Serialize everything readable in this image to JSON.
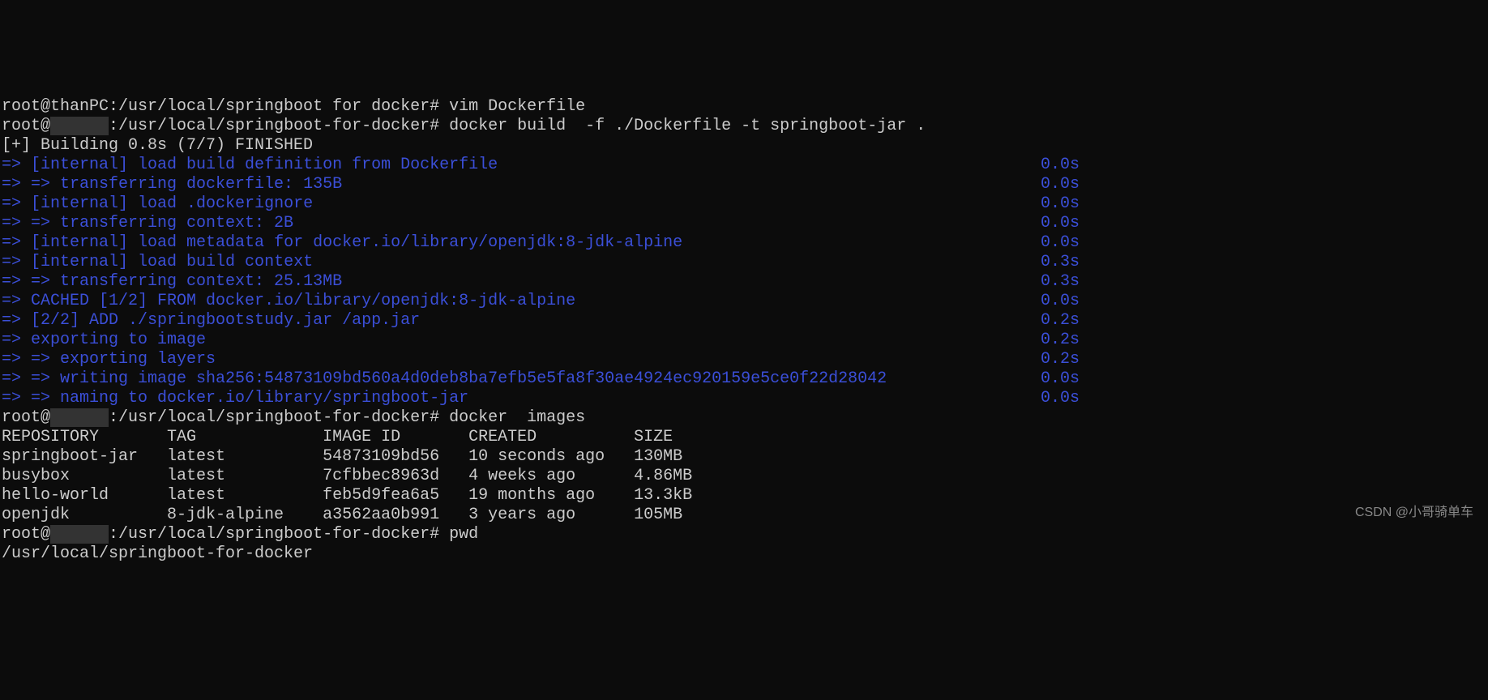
{
  "line0": "root@thanPC:/usr/local/springboot for docker# vim Dockerfile",
  "prompt1_a": "root@",
  "prompt1_blur": "      ",
  "prompt1_b": ":/usr/local/springboot-for-docker# ",
  "cmd1": "docker build  -f ./Dockerfile -t springboot-jar .",
  "building": "[+] Building 0.8s (7/7) FINISHED",
  "arrow1": "=> ",
  "arrow2": "=> => ",
  "steps": [
    {
      "pre": "=> ",
      "text": "[internal] load build definition from Dockerfile",
      "time": "0.0s"
    },
    {
      "pre": "=> => ",
      "text": "transferring dockerfile: 135B",
      "time": "0.0s"
    },
    {
      "pre": "=> ",
      "text": "[internal] load .dockerignore",
      "time": "0.0s"
    },
    {
      "pre": "=> => ",
      "text": "transferring context: 2B",
      "time": "0.0s"
    },
    {
      "pre": "=> ",
      "text": "[internal] load metadata for docker.io/library/openjdk:8-jdk-alpine",
      "time": "0.0s"
    },
    {
      "pre": "=> ",
      "text": "[internal] load build context",
      "time": "0.3s"
    },
    {
      "pre": "=> => ",
      "text": "transferring context: 25.13MB",
      "time": "0.3s"
    },
    {
      "pre": "=> ",
      "text": "CACHED [1/2] FROM docker.io/library/openjdk:8-jdk-alpine",
      "time": "0.0s"
    },
    {
      "pre": "=> ",
      "text": "[2/2] ADD ./springbootstudy.jar /app.jar",
      "time": "0.2s"
    },
    {
      "pre": "=> ",
      "text": "exporting to image",
      "time": "0.2s"
    },
    {
      "pre": "=> => ",
      "text": "exporting layers",
      "time": "0.2s"
    },
    {
      "pre": "=> => ",
      "text": "writing image sha256:54873109bd560a4d0deb8ba7efb5e5fa8f30ae4924ec920159e5ce0f22d28042",
      "time": "0.0s"
    },
    {
      "pre": "=> => ",
      "text": "naming to docker.io/library/springboot-jar",
      "time": "0.0s"
    }
  ],
  "prompt2_a": "root@",
  "prompt2_blur": "      ",
  "prompt2_b": ":/usr/local/springboot-for-docker# ",
  "cmd2": "docker  images",
  "table_header": "REPOSITORY       TAG             IMAGE ID       CREATED          SIZE",
  "table_rows": [
    "springboot-jar   latest          54873109bd56   10 seconds ago   130MB",
    "busybox          latest          7cfbbec8963d   4 weeks ago      4.86MB",
    "hello-world      latest          feb5d9fea6a5   19 months ago    13.3kB",
    "openjdk          8-jdk-alpine    a3562aa0b991   3 years ago      105MB"
  ],
  "prompt3_a": "root@",
  "prompt3_blur": "      ",
  "prompt3_b": ":/usr/local/springboot-for-docker# ",
  "cmd3": "pwd",
  "pwd_out": "/usr/local/springboot-for-docker",
  "watermark": "CSDN @小哥骑单车"
}
